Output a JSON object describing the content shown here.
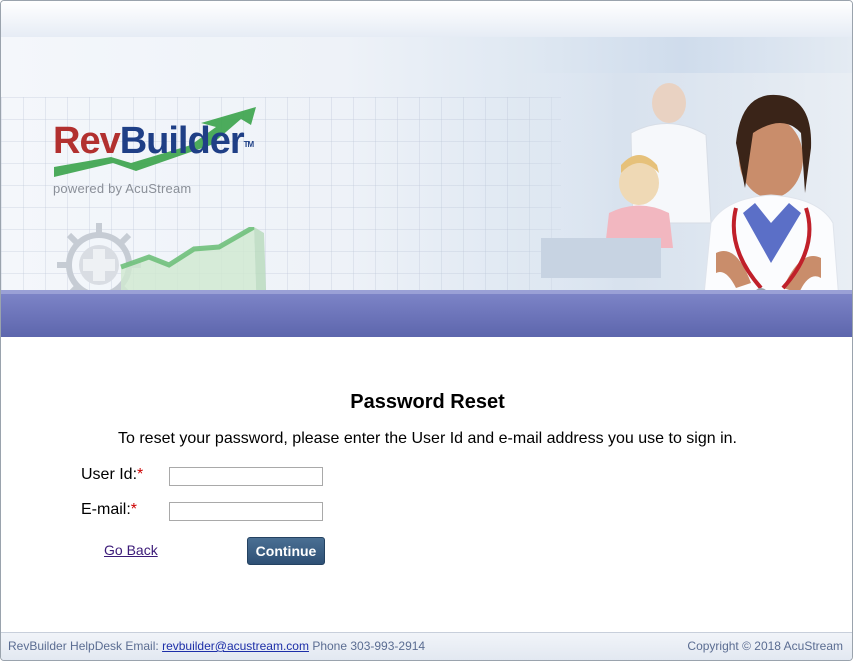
{
  "brand": {
    "logo_part1": "Rev",
    "logo_part2": "Builder",
    "logo_tm": "TM",
    "tagline": "powered by AcuStream"
  },
  "form": {
    "title": "Password Reset",
    "instructions": "To reset your password, please enter the User Id and e-mail address you use to sign in.",
    "user_id_label": "User Id:",
    "email_label": "E-mail:",
    "required_marker": "*",
    "user_id_value": "",
    "email_value": "",
    "go_back_label": "Go Back",
    "continue_label": "Continue"
  },
  "footer": {
    "helpdesk_prefix": "RevBuilder HelpDesk Email:",
    "email": "revbuilder@acustream.com",
    "phone": "Phone 303-993-2914",
    "copyright": "Copyright © 2018 AcuStream"
  },
  "colors": {
    "brand_red": "#b2302f",
    "brand_blue": "#1f3f86",
    "band": "#6a72b9",
    "button": "#2e5075",
    "required": "#cc0000"
  },
  "icons": [
    "gear-plus-icon",
    "growth-chart-icon",
    "logo-swoosh-icon"
  ]
}
